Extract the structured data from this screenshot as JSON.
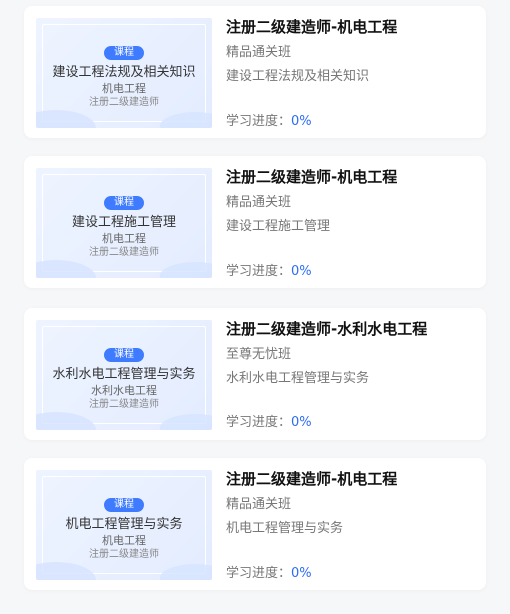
{
  "courses": [
    {
      "thumb_badge": "课程",
      "thumb_title": "建设工程法规及相关知识",
      "thumb_sub": "机电工程",
      "thumb_sub2": "注册二级建造师",
      "title": "注册二级建造师-机电工程",
      "class_name": "精品通关班",
      "subject": "建设工程法规及相关知识",
      "progress_label": "学习进度：",
      "progress_value": "0%"
    },
    {
      "thumb_badge": "课程",
      "thumb_title": "建设工程施工管理",
      "thumb_sub": "机电工程",
      "thumb_sub2": "注册二级建造师",
      "title": "注册二级建造师-机电工程",
      "class_name": "精品通关班",
      "subject": "建设工程施工管理",
      "progress_label": "学习进度：",
      "progress_value": "0%"
    },
    {
      "thumb_badge": "课程",
      "thumb_title": "水利水电工程管理与实务",
      "thumb_sub": "水利水电工程",
      "thumb_sub2": "注册二级建造师",
      "title": "注册二级建造师-水利水电工程",
      "class_name": "至尊无忧班",
      "subject": "水利水电工程管理与实务",
      "progress_label": "学习进度：",
      "progress_value": "0%"
    },
    {
      "thumb_badge": "课程",
      "thumb_title": "机电工程管理与实务",
      "thumb_sub": "机电工程",
      "thumb_sub2": "注册二级建造师",
      "title": "注册二级建造师-机电工程",
      "class_name": "精品通关班",
      "subject": "机电工程管理与实务",
      "progress_label": "学习进度：",
      "progress_value": "0%"
    }
  ]
}
